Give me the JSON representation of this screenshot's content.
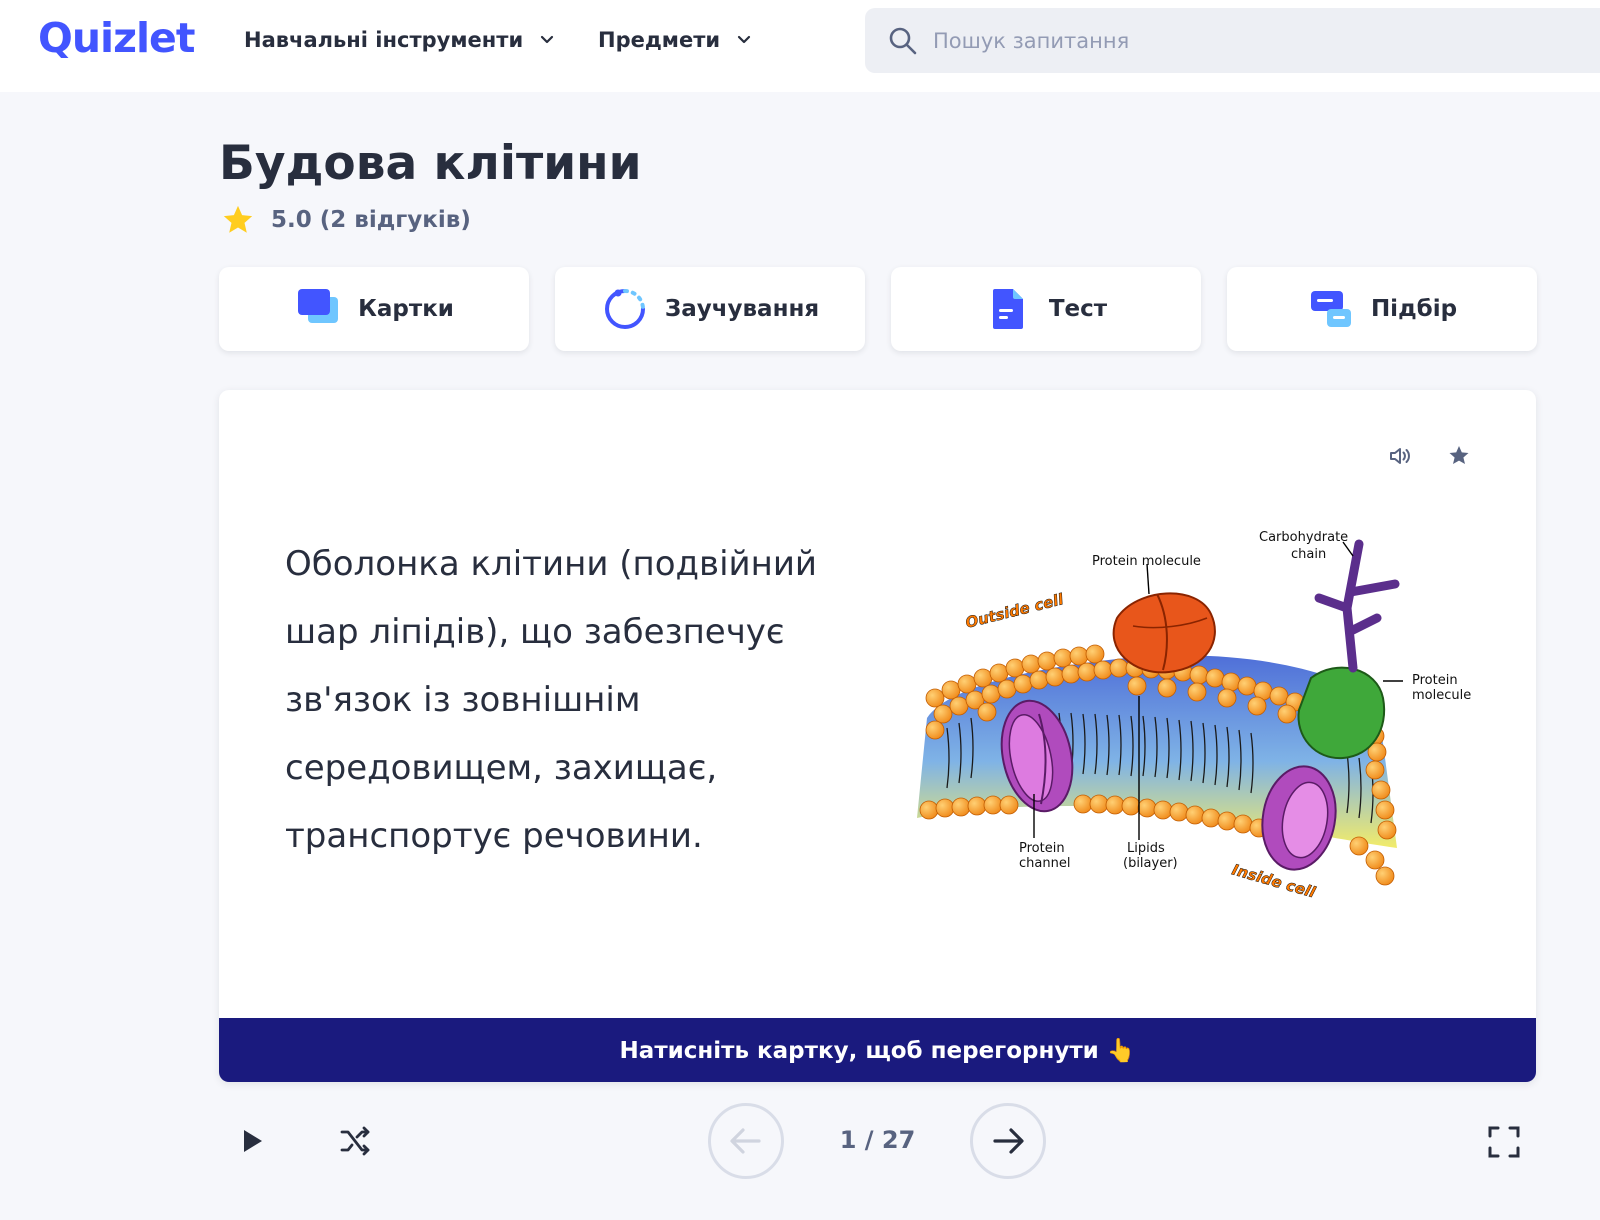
{
  "header": {
    "logo": "Quizlet",
    "nav": [
      {
        "label": "Навчальні інструменти",
        "icon": "chevron-down-icon"
      },
      {
        "label": "Предмети",
        "icon": "chevron-down-icon"
      }
    ],
    "search": {
      "placeholder": "Пошук запитання",
      "icon": "search-icon"
    }
  },
  "set": {
    "title": "Будова клітини",
    "rating": "5.0 (2 відгуків)",
    "rating_icon": "star-icon"
  },
  "modes": [
    {
      "label": "Картки",
      "icon": "flashcards-icon"
    },
    {
      "label": "Заучування",
      "icon": "learn-icon"
    },
    {
      "label": "Тест",
      "icon": "test-icon"
    },
    {
      "label": "Підбір",
      "icon": "match-icon"
    }
  ],
  "card": {
    "term": "Оболонка клітини (подвійний шар ліпідів), що забезпечує зв'язок із зовнішнім середовищем, захищає, транспортує речовини.",
    "flip_hint": "Натисніть картку, щоб перегорнути 👆",
    "icons": [
      "audio-icon",
      "star-icon"
    ],
    "diagram_labels": {
      "carbohydrate": [
        "Carbohydrate",
        "chain"
      ],
      "protein_top": "Protein molecule",
      "outside": "Outside cell",
      "protein_right": [
        "Protein",
        "molecule"
      ],
      "channel": [
        "Protein",
        "channel"
      ],
      "lipids": [
        "Lipids",
        "(bilayer)"
      ],
      "inside": "Inside cell"
    }
  },
  "controls": {
    "counter": "1 / 27",
    "icons": [
      "play-icon",
      "shuffle-icon",
      "arrow-left-icon",
      "arrow-right-icon",
      "fullscreen-icon"
    ]
  },
  "colors": {
    "brand": "#4255ff",
    "flip_bar": "#1a1a7e",
    "text": "#282e3e",
    "muted": "#586380"
  }
}
